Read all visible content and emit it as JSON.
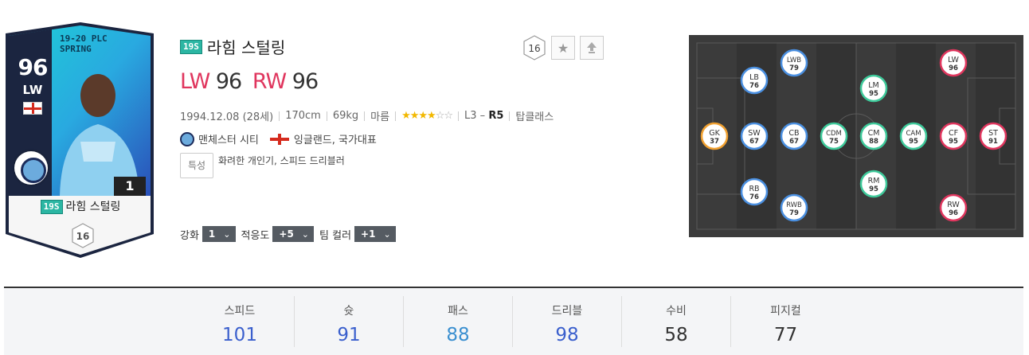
{
  "card": {
    "ovr": "96",
    "position": "LW",
    "season_line1": "19-20 PLC",
    "season_line2": "SPRING",
    "enhance_level": "1",
    "season_badge": "19S",
    "name": "라힘 스털링",
    "pay": "16"
  },
  "player": {
    "season_badge": "19S",
    "name": "라힘 스털링",
    "positions": [
      {
        "pos": "LW",
        "ovr": "96"
      },
      {
        "pos": "RW",
        "ovr": "96"
      }
    ],
    "birth": "1994.12.08 (28세)",
    "height": "170cm",
    "weight": "69kg",
    "body": "마름",
    "skill_stars": 4,
    "skill_max": 6,
    "stars_filled": "★★★★",
    "stars_empty": "☆☆",
    "foot_prefix": "L3 –",
    "foot_strong": "R5",
    "rating_class": "탑클래스",
    "club": "맨체스터 시티",
    "nation": "잉글랜드, 국가대표",
    "trait_label": "특성",
    "traits": "화려한 개인기, 스피드 드리블러"
  },
  "top_buttons": {
    "pay": "16",
    "favorite_icon": "star-icon",
    "upload_icon": "arrow-up-icon"
  },
  "controls": {
    "enhance_label": "강화",
    "enhance_value": "1",
    "adapt_label": "적응도",
    "adapt_value": "+5",
    "teamcolor_label": "팀 컬러",
    "teamcolor_value": "+1"
  },
  "colors": {
    "position_red": "#e0365e",
    "fw": "#e0365e",
    "mf": "#3ec99a",
    "df": "#4a8fe0",
    "gk": "#f0a030",
    "stat_blue": "#3a5fcd",
    "stat_dark": "#333333"
  },
  "pitch_positions": [
    {
      "pos": "GK",
      "ovr": "37",
      "group": "gk"
    },
    {
      "pos": "SW",
      "ovr": "67",
      "group": "df"
    },
    {
      "pos": "CB",
      "ovr": "67",
      "group": "df"
    },
    {
      "pos": "LB",
      "ovr": "76",
      "group": "df"
    },
    {
      "pos": "RB",
      "ovr": "76",
      "group": "df"
    },
    {
      "pos": "LWB",
      "ovr": "79",
      "group": "df"
    },
    {
      "pos": "RWB",
      "ovr": "79",
      "group": "df"
    },
    {
      "pos": "CDM",
      "ovr": "75",
      "group": "mf"
    },
    {
      "pos": "CM",
      "ovr": "88",
      "group": "mf"
    },
    {
      "pos": "LM",
      "ovr": "95",
      "group": "mf"
    },
    {
      "pos": "RM",
      "ovr": "95",
      "group": "mf"
    },
    {
      "pos": "CAM",
      "ovr": "95",
      "group": "mf"
    },
    {
      "pos": "LW",
      "ovr": "96",
      "group": "fw"
    },
    {
      "pos": "RW",
      "ovr": "96",
      "group": "fw"
    },
    {
      "pos": "CF",
      "ovr": "95",
      "group": "fw"
    },
    {
      "pos": "ST",
      "ovr": "91",
      "group": "fw"
    }
  ],
  "stats": [
    {
      "label": "스피드",
      "value": "101",
      "color": "#3a5fcd"
    },
    {
      "label": "슛",
      "value": "91",
      "color": "#3a5fcd"
    },
    {
      "label": "패스",
      "value": "88",
      "color": "#3a8fd0"
    },
    {
      "label": "드리블",
      "value": "98",
      "color": "#3a5fcd"
    },
    {
      "label": "수비",
      "value": "58",
      "color": "#333333"
    },
    {
      "label": "피지컬",
      "value": "77",
      "color": "#333333"
    }
  ]
}
